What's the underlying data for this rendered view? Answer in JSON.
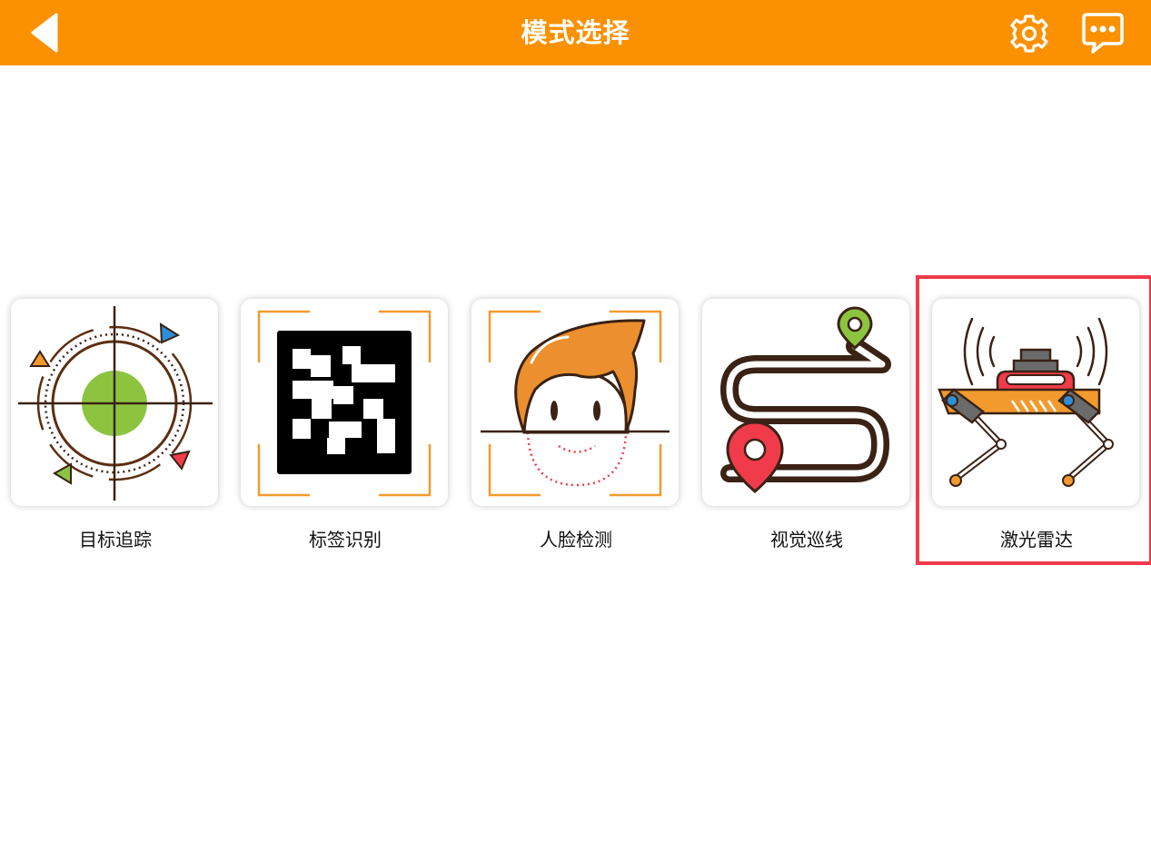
{
  "header": {
    "title": "模式选择",
    "back_icon": "back-arrow-icon",
    "settings_icon": "gear-icon",
    "chat_icon": "chat-bubble-icon",
    "bar_color": "#fb9100"
  },
  "modes": [
    {
      "label": "目标追踪",
      "icon": "target-tracking-icon"
    },
    {
      "label": "标签识别",
      "icon": "tag-recognition-icon"
    },
    {
      "label": "人脸检测",
      "icon": "face-detection-icon"
    },
    {
      "label": "视觉巡线",
      "icon": "line-following-icon"
    },
    {
      "label": "激光雷达",
      "icon": "lidar-robot-dog-icon"
    }
  ],
  "selected_mode": "激光雷达",
  "highlight_color": "#ef3b4a"
}
